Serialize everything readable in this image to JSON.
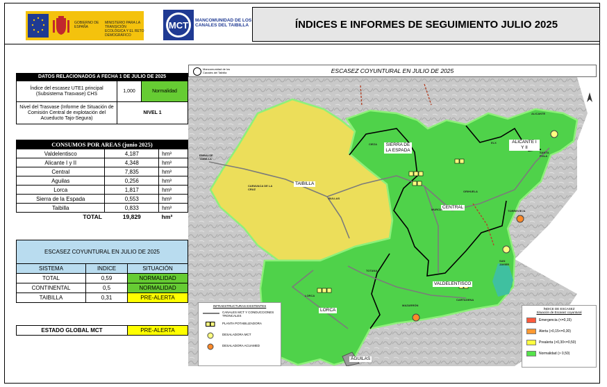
{
  "header": {
    "gov_line1": "GOBIERNO DE ESPAÑA",
    "gov_line2": "MINISTERIO PARA LA TRANSICIÓN ECOLÓGICA Y EL RETO DEMOGRÁFICO",
    "mct_logo_text": "MANCOMUNIDAD DE LOS CANALES DEL TAIBILLA",
    "mct_letters": "MCT",
    "title": "ÍNDICES E INFORMES DE SEGUIMIENTO JULIO 2025"
  },
  "datos": {
    "title": "DATOS RELACIONADOS A FECHA 1 DE JULIO DE 2025",
    "row1_label": "Índice del escasez UTE1 principal (Subsistema Trasvase) CHS",
    "row1_value": "1,000",
    "row1_status": "Normalidad",
    "row2_label": "Nivel del Trasvase (Informe de Situación de Comisión Central de explotación del Acueducto Tajo-Segura)",
    "row2_value": "NIVEL 1"
  },
  "consumos": {
    "title": "CONSUMOS POR AREAS (junio 2025)",
    "unit": "hm³",
    "rows": [
      {
        "area": "Valdelentisco",
        "value": "4,187"
      },
      {
        "area": "Alicante I y II",
        "value": "4,348"
      },
      {
        "area": "Central",
        "value": "7,835"
      },
      {
        "area": "Aguilas",
        "value": "0,256"
      },
      {
        "area": "Lorca",
        "value": "1,817"
      },
      {
        "area": "Sierra de la Espada",
        "value": "0,553"
      },
      {
        "area": "Taibilla",
        "value": "0,833"
      }
    ],
    "total_label": "TOTAL",
    "total_value": "19,829",
    "total_unit": "hm³"
  },
  "escasez": {
    "title": "ESCASEZ COYUNTURAL EN JULIO DE 2025",
    "col_sistema": "SISTEMA",
    "col_indice": "INDICE",
    "col_situacion": "SITUACIÓN",
    "rows": [
      {
        "sistema": "TOTAL",
        "indice": "0,59",
        "situacion": "NORMALIDAD"
      },
      {
        "sistema": "CONTINENTAL",
        "indice": "0,5",
        "situacion": "NORMALIDAD"
      },
      {
        "sistema": "TAIBILLA",
        "indice": "0,31",
        "situacion": "PRE-ALERTA"
      }
    ]
  },
  "global": {
    "label": "ESTADO GLOBAL MCT",
    "value": "PRE-ALERTA"
  },
  "map": {
    "title": "ESCASEZ COYUNTURAL EN JULIO DE 2025",
    "org": "Mancomunidad de los Canales del Taibilla",
    "zones": {
      "taibilla": "TAIBILLA",
      "sierra": "SIERRA DE LA ESPADA",
      "central": "CENTRAL",
      "alicante": "ALICANTE I Y II",
      "lorca": "LORCA",
      "valdelentisco": "VALDELENTISCO",
      "aguilas": "ÁGUILAS"
    },
    "places": {
      "embalse": "EMBALSE TAIBILLA",
      "caravaca": "CARAVACA DE LA CRUZ",
      "bullas": "BULLAS",
      "cieza": "CIEZA",
      "orihuela": "ORIHUELA",
      "murcia": "MURCIA",
      "alicante": "ALICANTE",
      "elx": "ELX",
      "santa_pola": "SANTA POLA",
      "torrevieja": "TORREVIEJA",
      "san_javier": "SAN JAVIER",
      "totana": "TOTANA",
      "lorca": "LORCA",
      "mazarron": "MAZARRÓN",
      "cartagena": "CARTAGENA"
    },
    "legend_infra": {
      "title": "INFRAESTRUCTURAS EXISTENTES",
      "items": [
        {
          "icon": "canal-line-icon",
          "label": "CANALES MCT Y CONDUCCIONES TRONCALES"
        },
        {
          "icon": "potabilizadora-icon",
          "label": "PLANTA POTABILIZADORA"
        },
        {
          "icon": "desaladora-mct-icon",
          "label": "DESALADORA MCT"
        },
        {
          "icon": "desaladora-acuamed-icon",
          "label": "DESALADORA ACUAMED"
        }
      ]
    },
    "legend_idx": {
      "title": "ÍNDICE DE ESCASEZ",
      "subtitle": "Situación de Escasez coyuntural",
      "items": [
        {
          "label": "Emergencia (<=0,15)",
          "color": "#ff5a3c"
        },
        {
          "label": "Alerta (>0,15<=0,30)",
          "color": "#ff9a33"
        },
        {
          "label": "Prealerta (>0,30<=0,50)",
          "color": "#ffff40"
        },
        {
          "label": "Normalidad (> 0,50)",
          "color": "#55e34a"
        }
      ]
    },
    "colors": {
      "taibilla": "#ecde5a",
      "green": "#4fd24a",
      "sea": "#ffffff",
      "terrain": "#c8c8c8"
    }
  }
}
